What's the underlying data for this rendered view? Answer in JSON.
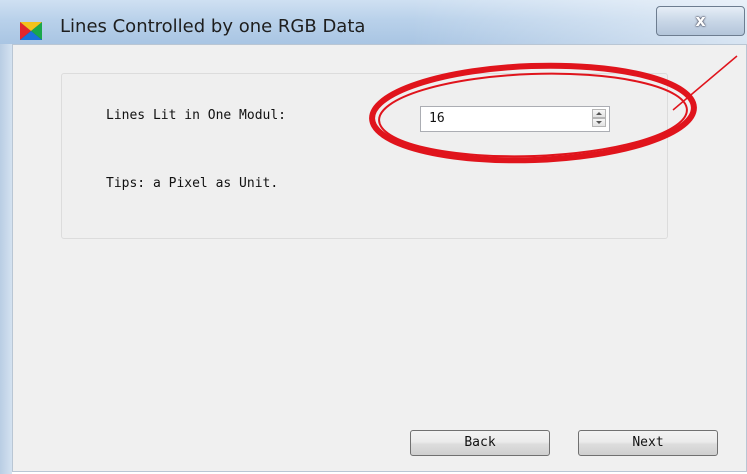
{
  "window": {
    "title": "Lines Controlled by one RGB Data",
    "close_label": "x"
  },
  "form": {
    "lines_label": "Lines Lit in One Modul:",
    "lines_value": "16",
    "tips": "Tips: a Pixel as Unit."
  },
  "buttons": {
    "back": "Back",
    "next": "Next"
  },
  "colors": {
    "highlight": "#e0141c",
    "titlebar": "#b9d1ea",
    "window_bg": "#f0f0f0"
  }
}
